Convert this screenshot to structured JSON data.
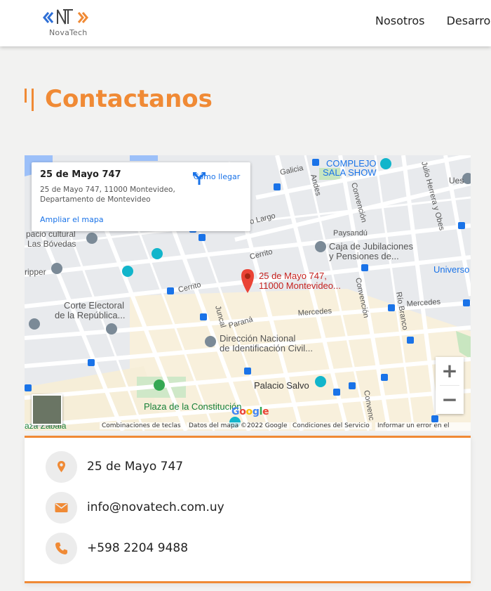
{
  "header": {
    "logo_text": "NovaTech",
    "nav": [
      "Nosotros",
      "Desarrollo"
    ]
  },
  "page": {
    "title": "Contactanos"
  },
  "map": {
    "place_title": "25 de Mayo 747",
    "place_address": "25 de Mayo 747, 11000 Montevideo, Departamento de Montevideo",
    "enlarge_link": "Ampliar el mapa",
    "directions_label": "Cómo llegar",
    "pin_label_1": "25 de Mayo 747,",
    "pin_label_2": "11000 Montevideo...",
    "labels": {
      "complejo1": "COMPLEJO",
      "complejo2": "SALA SHOW",
      "galicia": "Galicia",
      "andes": "Andes",
      "conv1": "Convención",
      "conv2": "Convención",
      "conv3": "Convenc",
      "julio": "Julio Herrera y Obes",
      "ues": "Ues",
      "largo": "o Largo",
      "paysandu": "Paysandú",
      "caja1": "Caja de Jubilaciones",
      "caja2": "y Pensiones de...",
      "cerrito1": "Cerrito",
      "cerrito2": "Cerrito",
      "rio_branco": "Río Branco",
      "universo": "Universo",
      "mercedes1": "Mercedes",
      "mercedes2": "Mercedes",
      "corte1": "Corte Electoral",
      "corte2": "de la República...",
      "juncal": "Juncal",
      "parana": "Paraná",
      "dir1": "Dirección Nacional",
      "dir2": "de Identificación Civil...",
      "palacio": "Palacio Salvo",
      "plaza": "Plaza de la Constitución",
      "zabala": "aza Zabala",
      "cultural1": "pacio cultural",
      "cultural2": "Las Bóvedas",
      "ripper": "ripper"
    },
    "footer": {
      "keys": "Combinaciones de teclas",
      "data": "Datos del mapa ©2022 Google",
      "terms": "Condiciones del Servicio",
      "report": "Informar un error en el mapa"
    },
    "google": [
      "G",
      "o",
      "o",
      "g",
      "l",
      "e"
    ],
    "zoom_in": "+",
    "zoom_out": "−"
  },
  "contact": {
    "address": "25 de Mayo 747",
    "email": "info@novatech.com.uy",
    "phone": "+598 2204 9488"
  },
  "colors": {
    "accent": "#f08a35",
    "link": "#1a73e8"
  }
}
